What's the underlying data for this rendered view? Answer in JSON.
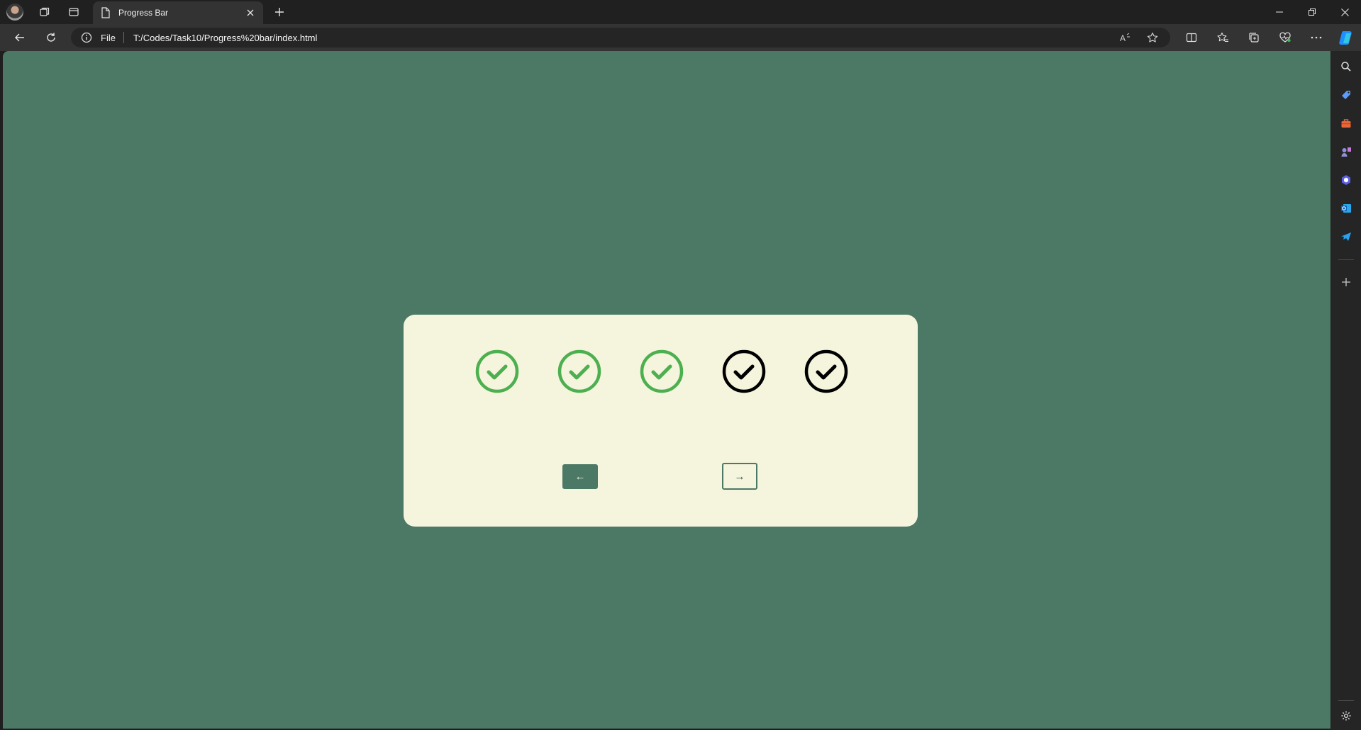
{
  "browser": {
    "tab": {
      "title": "Progress Bar"
    },
    "address": {
      "scheme_label": "File",
      "url": "T:/Codes/Task10/Progress%20bar/index.html"
    }
  },
  "progress": {
    "total_steps": 5,
    "completed_steps": 3,
    "complete_color": "#4caf50",
    "incomplete_color": "#000000",
    "steps": [
      {
        "state": "complete",
        "icon": "check-circle-icon"
      },
      {
        "state": "complete",
        "icon": "check-circle-icon"
      },
      {
        "state": "complete",
        "icon": "check-circle-icon"
      },
      {
        "state": "incomplete",
        "icon": "check-circle-icon"
      },
      {
        "state": "incomplete",
        "icon": "check-circle-icon"
      }
    ],
    "prev_label": "←",
    "next_label": "→"
  },
  "colors": {
    "page_background": "#4c7866",
    "card_background": "#f5f4dc"
  }
}
